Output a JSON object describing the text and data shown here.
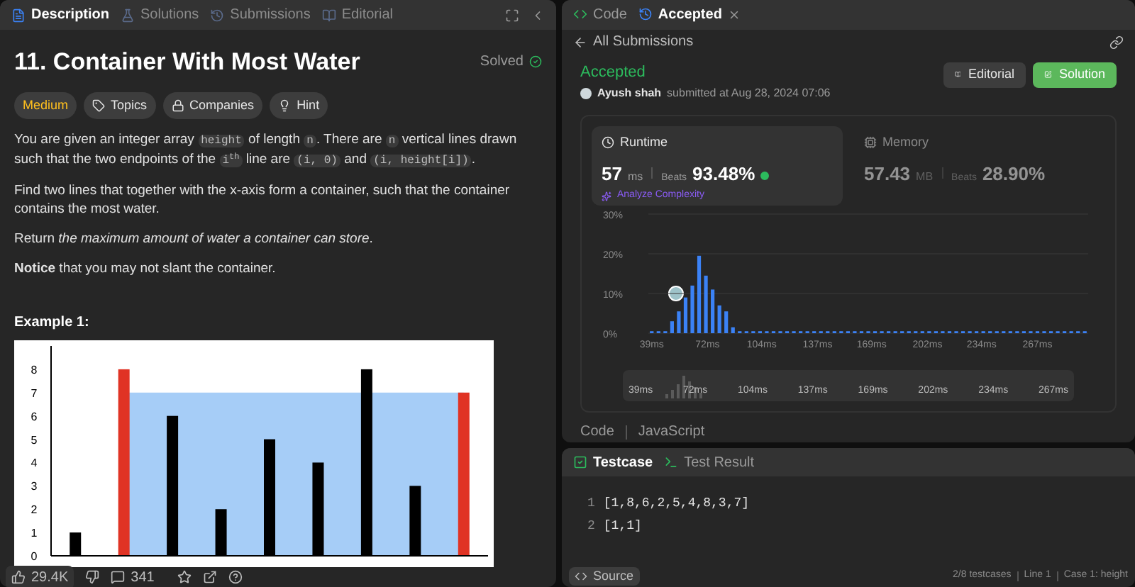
{
  "left_tabs": [
    {
      "label": "Description",
      "selected": true
    },
    {
      "label": "Solutions",
      "selected": false
    },
    {
      "label": "Submissions",
      "selected": false
    },
    {
      "label": "Editorial",
      "selected": false
    }
  ],
  "problem": {
    "title": "11. Container With Most Water",
    "status": "Solved",
    "difficulty": "Medium",
    "tags": [
      "Topics",
      "Companies",
      "Hint"
    ],
    "paragraphs": [
      [
        {
          "kind": "text",
          "text": "You are given an integer array "
        },
        {
          "kind": "code",
          "text": "height"
        },
        {
          "kind": "text",
          "text": " of length "
        },
        {
          "kind": "code",
          "text": "n"
        },
        {
          "kind": "text",
          "text": ". There are "
        },
        {
          "kind": "code",
          "text": "n"
        },
        {
          "kind": "text",
          "text": " vertical lines drawn such that the two endpoints of the "
        },
        {
          "kind": "code",
          "text": "i$^{th}$"
        },
        {
          "kind": "text",
          "text": " line are "
        },
        {
          "kind": "code",
          "text": "(i, 0)"
        },
        {
          "kind": "text",
          "text": " and "
        },
        {
          "kind": "code",
          "text": "(i, height[i])"
        },
        {
          "kind": "text",
          "text": "."
        }
      ],
      [
        {
          "kind": "text",
          "text": "Find two lines that together with the x-axis form a container, such that the container contains the most water."
        }
      ],
      [
        {
          "kind": "text",
          "text": "Return *the maximum amount of water a container can store*."
        }
      ],
      [
        {
          "kind": "text",
          "text": "**Notice** that you may not slant the container."
        }
      ]
    ],
    "example_heading": "Example 1:",
    "chart_data": {
      "type": "bar",
      "values": [
        1,
        8,
        6,
        2,
        5,
        4,
        8,
        3,
        7
      ],
      "ylim": [
        0,
        9
      ],
      "yticks": [
        0,
        1,
        2,
        3,
        4,
        5,
        6,
        7,
        8
      ]
    }
  },
  "footer": {
    "likes": "29.4K",
    "comments": "341"
  },
  "right_tabs": [
    {
      "label": "Code",
      "selected": false
    },
    {
      "label": "Accepted",
      "selected": true
    }
  ],
  "back_link": "All Submissions",
  "result": {
    "status": "Accepted",
    "user": "Ayush shah",
    "submitted": "submitted at Aug 28, 2024 07:06",
    "buttons": [
      {
        "label": "Editorial",
        "kind": "secondary"
      },
      {
        "label": "Solution",
        "kind": "primary"
      }
    ]
  },
  "stats": [
    {
      "kind": "runtime",
      "label": "Runtime",
      "value": "57",
      "unit": "ms",
      "beats_label": "Beats",
      "beats": "93.48%",
      "action": "Analyze Complexity",
      "selected": true
    },
    {
      "kind": "memory",
      "label": "Memory",
      "value": "57.43",
      "unit": "MB",
      "beats_label": "Beats",
      "beats": "28.90%",
      "selected": false
    }
  ],
  "runtime_chart": {
    "chart_data": {
      "type": "bar",
      "yticks": [
        {
          "value": 0,
          "label": "0%"
        },
        {
          "value": 10,
          "label": "10%"
        },
        {
          "value": 20,
          "label": "20%"
        },
        {
          "value": 30,
          "label": "30%"
        }
      ],
      "ylim": [
        0,
        30
      ],
      "xlim": [
        37,
        297
      ],
      "xticks": [
        {
          "value": 39,
          "label": "39ms"
        },
        {
          "value": 72,
          "label": "72ms"
        },
        {
          "value": 104,
          "label": "104ms"
        },
        {
          "value": 137,
          "label": "137ms"
        },
        {
          "value": 169,
          "label": "169ms"
        },
        {
          "value": 202,
          "label": "202ms"
        },
        {
          "value": 234,
          "label": "234ms"
        },
        {
          "value": 267,
          "label": "267ms"
        }
      ],
      "x": [
        39,
        43,
        47,
        51,
        55,
        59,
        63,
        67,
        71,
        75,
        79,
        83,
        87,
        91,
        95,
        99,
        103,
        107,
        111,
        115,
        119,
        123,
        127,
        131,
        135,
        139,
        143,
        147,
        151,
        155,
        159,
        163,
        167,
        171,
        175,
        179,
        183,
        187,
        191,
        195,
        199,
        203,
        207,
        211,
        215,
        219,
        223,
        227,
        231,
        235,
        239,
        243,
        247,
        251,
        255,
        259,
        263,
        267,
        271,
        275,
        279,
        283,
        287,
        291,
        295
      ],
      "values": [
        0.5,
        0.5,
        0.5,
        3,
        5.5,
        9,
        12,
        19.5,
        14.5,
        11,
        7,
        5.5,
        1.5,
        0.5,
        0.5,
        0.5,
        0.5,
        0.5,
        0.5,
        0.5,
        0.5,
        0.5,
        0.5,
        0.5,
        0.5,
        0.5,
        0.5,
        0.5,
        0.5,
        0.5,
        0.5,
        0.5,
        0.5,
        0.5,
        0.5,
        0.5,
        0.5,
        0.5,
        0.5,
        0.5,
        0.5,
        0.5,
        0.5,
        0.5,
        0.5,
        0.5,
        0.5,
        0.5,
        0.5,
        0.5,
        0.5,
        0.5,
        0.5,
        0.5,
        0.5,
        0.5,
        0.5,
        0.5,
        0.5,
        0.5,
        0.5,
        0.5,
        0.5,
        0.5,
        0.5
      ]
    },
    "navigator_labels": [
      "39ms",
      "72ms",
      "104ms",
      "137ms",
      "169ms",
      "202ms",
      "234ms",
      "267ms"
    ]
  },
  "code_section": {
    "title": "Code",
    "language": "JavaScript"
  },
  "bottom_tabs": [
    {
      "label": "Testcase",
      "selected": true
    },
    {
      "label": "Test Result",
      "selected": false
    }
  ],
  "testcase_lines": [
    {
      "number": "1",
      "text": "[1,8,6,2,5,4,8,3,7]"
    },
    {
      "number": "2",
      "text": "[1,1]"
    }
  ],
  "source_button": "Source",
  "status_bar": [
    "2/8 testcases",
    "Line 1",
    "Case 1: height"
  ]
}
